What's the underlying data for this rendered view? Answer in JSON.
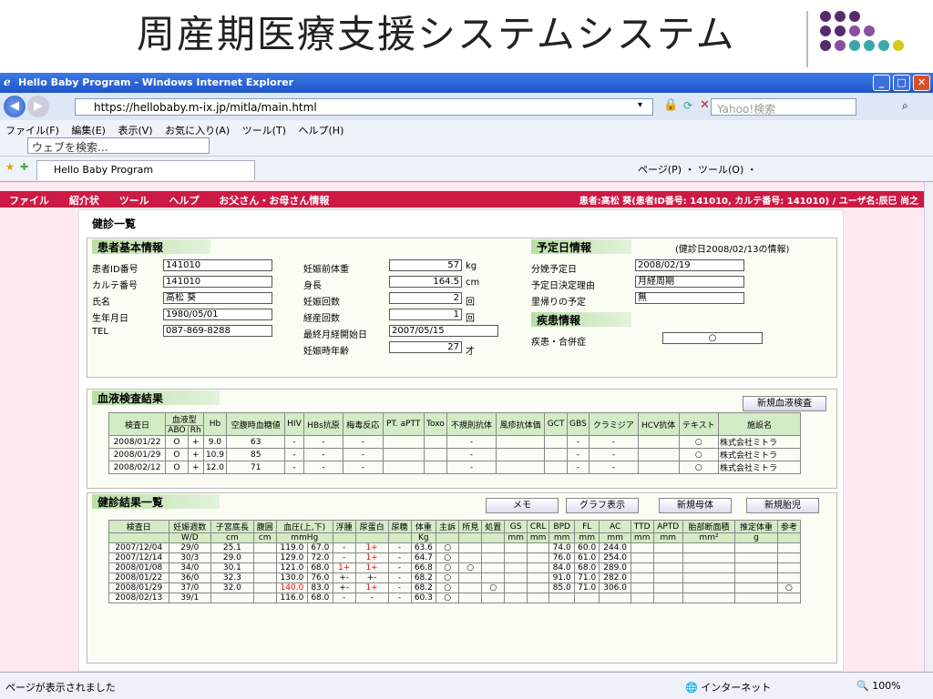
{
  "slide": {
    "title": "周産期医療支援システムシステム"
  },
  "window": {
    "title": "Hello Baby Program - Windows Internet Explorer"
  },
  "browser": {
    "url": "https://hellobaby.m-ix.jp/mitla/main.html",
    "search_placeholder": "Yahoo!検索",
    "menu": [
      "ファイル(F)",
      "編集(E)",
      "表示(V)",
      "お気に入り(A)",
      "ツール(T)",
      "ヘルプ(H)"
    ],
    "web_search_placeholder": "ウェブを検索...",
    "tab_label": "Hello Baby Program",
    "tools_text": "ページ(P) ・ ツール(O) ・"
  },
  "app": {
    "menu": [
      "ファイル",
      "紹介状",
      "ツール",
      "ヘルプ",
      "お父さん・お母さん情報"
    ],
    "patient_info": "患者:高松 葵(患者ID番号: 141010, カルテ番号: 141010) / ユーザ名:辰巳 尚之",
    "page_title": "健診一覧"
  },
  "patient": {
    "section": "患者基本情報",
    "fields": [
      {
        "label": "患者ID番号",
        "value": "141010"
      },
      {
        "label": "カルテ番号",
        "value": "141010"
      },
      {
        "label": "氏名",
        "value": "高松 葵"
      },
      {
        "label": "生年月日",
        "value": "1980/05/01"
      },
      {
        "label": "TEL",
        "value": "087-869-8288"
      }
    ],
    "fields2": [
      {
        "label": "妊娠前体重",
        "value": "57",
        "unit": "kg"
      },
      {
        "label": "身長",
        "value": "164.5",
        "unit": "cm"
      },
      {
        "label": "妊娠回数",
        "value": "2",
        "unit": "回"
      },
      {
        "label": "経産回数",
        "value": "1",
        "unit": "回"
      },
      {
        "label": "最終月経開始日",
        "value": "2007/05/15",
        "unit": ""
      },
      {
        "label": "妊娠時年齢",
        "value": "27",
        "unit": "才"
      }
    ]
  },
  "schedule": {
    "section": "予定日情報",
    "note": "(健診日2008/02/13の情報)",
    "fields": [
      {
        "label": "分娩予定日",
        "value": "2008/02/19"
      },
      {
        "label": "予定日決定理由",
        "value": "月経周期"
      },
      {
        "label": "里帰りの予定",
        "value": "無"
      }
    ],
    "disease_section": "疾患情報",
    "disease_label": "疾患・合併症",
    "disease_value": "○"
  },
  "blood": {
    "section": "血液検査結果",
    "new_button": "新規血液検査",
    "headers": [
      "検査日",
      "血液型",
      "Hb",
      "空腹時血糖値",
      "HIV",
      "HBs抗原",
      "梅毒反応",
      "PT. aPTT",
      "Toxo",
      "不規則抗体",
      "風疹抗体価",
      "GCT",
      "GBS",
      "クラミジア",
      "HCV抗体",
      "テキスト",
      "施設名"
    ],
    "subheaders": [
      "ABO",
      "Rh"
    ],
    "rows": [
      [
        "2008/01/22",
        "O",
        "+",
        "9.0",
        "63",
        "-",
        "-",
        "-",
        "",
        "",
        "-",
        "",
        "",
        "-",
        "-",
        "",
        "○",
        "株式会社ミトラ"
      ],
      [
        "2008/01/29",
        "O",
        "+",
        "10.9",
        "85",
        "-",
        "-",
        "-",
        "",
        "",
        "-",
        "",
        "",
        "-",
        "-",
        "",
        "○",
        "株式会社ミトラ"
      ],
      [
        "2008/02/12",
        "O",
        "+",
        "12.0",
        "71",
        "-",
        "-",
        "-",
        "",
        "",
        "-",
        "",
        "",
        "-",
        "-",
        "",
        "○",
        "株式会社ミトラ"
      ]
    ]
  },
  "checkups": {
    "section": "健診結果一覧",
    "buttons": [
      "メモ",
      "グラフ表示",
      "新規母体",
      "新規胎児"
    ],
    "headers": [
      "検査日",
      "妊娠週数",
      "子宮底長",
      "腹囲",
      "血圧(上,下)",
      "浮腫",
      "尿蛋白",
      "尿糖",
      "体重",
      "主訴",
      "所見",
      "処置",
      "GS",
      "CRL",
      "BPD",
      "FL",
      "AC",
      "TTD",
      "APTD",
      "胎部断面積",
      "推定体重",
      "参考"
    ],
    "units": [
      "",
      "W/D",
      "cm",
      "cm",
      "mmHg",
      "",
      "",
      "",
      "Kg",
      "",
      "",
      "",
      "mm",
      "mm",
      "mm",
      "mm",
      "mm",
      "mm",
      "mm",
      "mm²",
      "g",
      ""
    ],
    "rows": [
      [
        "2007/12/04",
        "29/0",
        "25.1",
        "",
        "119.0",
        "67.0",
        "-",
        "1+",
        "-",
        "63.6",
        "○",
        "",
        "",
        "",
        "",
        "74.0",
        "60.0",
        "244.0",
        "",
        "",
        "",
        "",
        ""
      ],
      [
        "2007/12/14",
        "30/3",
        "29.0",
        "",
        "129.0",
        "72.0",
        "-",
        "1+",
        "-",
        "64.7",
        "○",
        "",
        "",
        "",
        "",
        "76.0",
        "61.0",
        "254.0",
        "",
        "",
        "",
        "",
        ""
      ],
      [
        "2008/01/08",
        "34/0",
        "30.1",
        "",
        "121.0",
        "68.0",
        "1+",
        "1+",
        "-",
        "66.8",
        "○",
        "○",
        "",
        "",
        "",
        "84.0",
        "68.0",
        "289.0",
        "",
        "",
        "",
        "",
        ""
      ],
      [
        "2008/01/22",
        "36/0",
        "32.3",
        "",
        "130.0",
        "76.0",
        "+-",
        "+-",
        "-",
        "68.2",
        "○",
        "",
        "",
        "",
        "",
        "91.0",
        "71.0",
        "282.0",
        "",
        "",
        "",
        "",
        ""
      ],
      [
        "2008/01/29",
        "37/0",
        "32.0",
        "",
        "140.0",
        "83.0",
        "+-",
        "1+",
        "-",
        "68.2",
        "○",
        "",
        "○",
        "",
        "",
        "85.0",
        "71.0",
        "306.0",
        "",
        "",
        "",
        "",
        "○"
      ],
      [
        "2008/02/13",
        "39/1",
        "",
        "",
        "116.0",
        "68.0",
        "-",
        "-",
        "-",
        "60.3",
        "○",
        "",
        "",
        "",
        "",
        "",
        "",
        "",
        "",
        "",
        "",
        "",
        ""
      ]
    ]
  },
  "status": {
    "left": "ページが表示されました",
    "zone": "インターネット",
    "zoom": "100%"
  },
  "colors": {
    "app_menu": "#cc1a44",
    "section_header": "#b9dfa6",
    "alert": "#e01010"
  }
}
